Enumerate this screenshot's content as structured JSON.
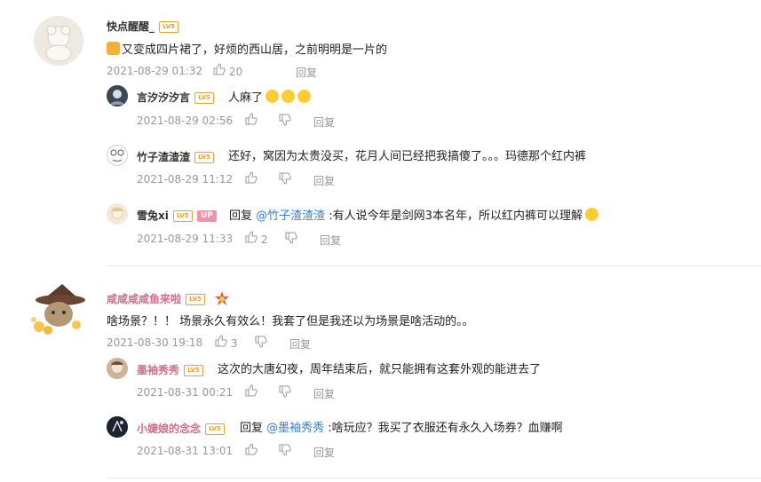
{
  "colors": {
    "level_badge": "#f0a030",
    "mention": "#2f7fd6",
    "pink_name": "#d86a8f",
    "up_badge": "#f78fa7"
  },
  "level_label": "LV5",
  "up_label": "UP",
  "reply_label": "回复",
  "threads": [
    {
      "author": "快点醒醒_",
      "text": "又变成四片裙了，好烦的西山居，之前明明是一片的",
      "time": "2021-08-29 01:32",
      "likes": "20",
      "replies": [
        {
          "author": "言汐汐汐言",
          "text": "人麻了",
          "time": "2021-08-29 02:56",
          "likes": ""
        },
        {
          "author": "竹子渣渣渣",
          "text": "还好，窝因为太贵没买，花月人间已经把我搞傻了。。。玛德那个红内裤",
          "time": "2021-08-29 11:12",
          "likes": ""
        },
        {
          "author": "雪兔xi",
          "prefix": "回复 ",
          "mention": "@竹子渣渣渣",
          "text": " :有人说今年是剑网3本名年，所以红内裤可以理解",
          "time": "2021-08-29 11:33",
          "likes": "2"
        }
      ]
    },
    {
      "author": "咸咸咸咸鱼来啦",
      "text": "啥场景？！！ 场景永久有效么！我套了但是我还以为场景是啥活动的。。",
      "time": "2021-08-30 19:18",
      "likes": "3",
      "replies": [
        {
          "author": "墨袖秀秀",
          "text": "这次的大唐幻夜，周年结束后，就只能拥有这套外观的能进去了",
          "time": "2021-08-31 00:21",
          "likes": ""
        },
        {
          "author": "小婕娘的念念",
          "prefix": "回复 ",
          "mention": "@墨袖秀秀",
          "text": " :啥玩应？我买了衣服还有永久入场券？血赚啊",
          "time": "2021-08-31 13:01",
          "likes": ""
        }
      ]
    }
  ]
}
